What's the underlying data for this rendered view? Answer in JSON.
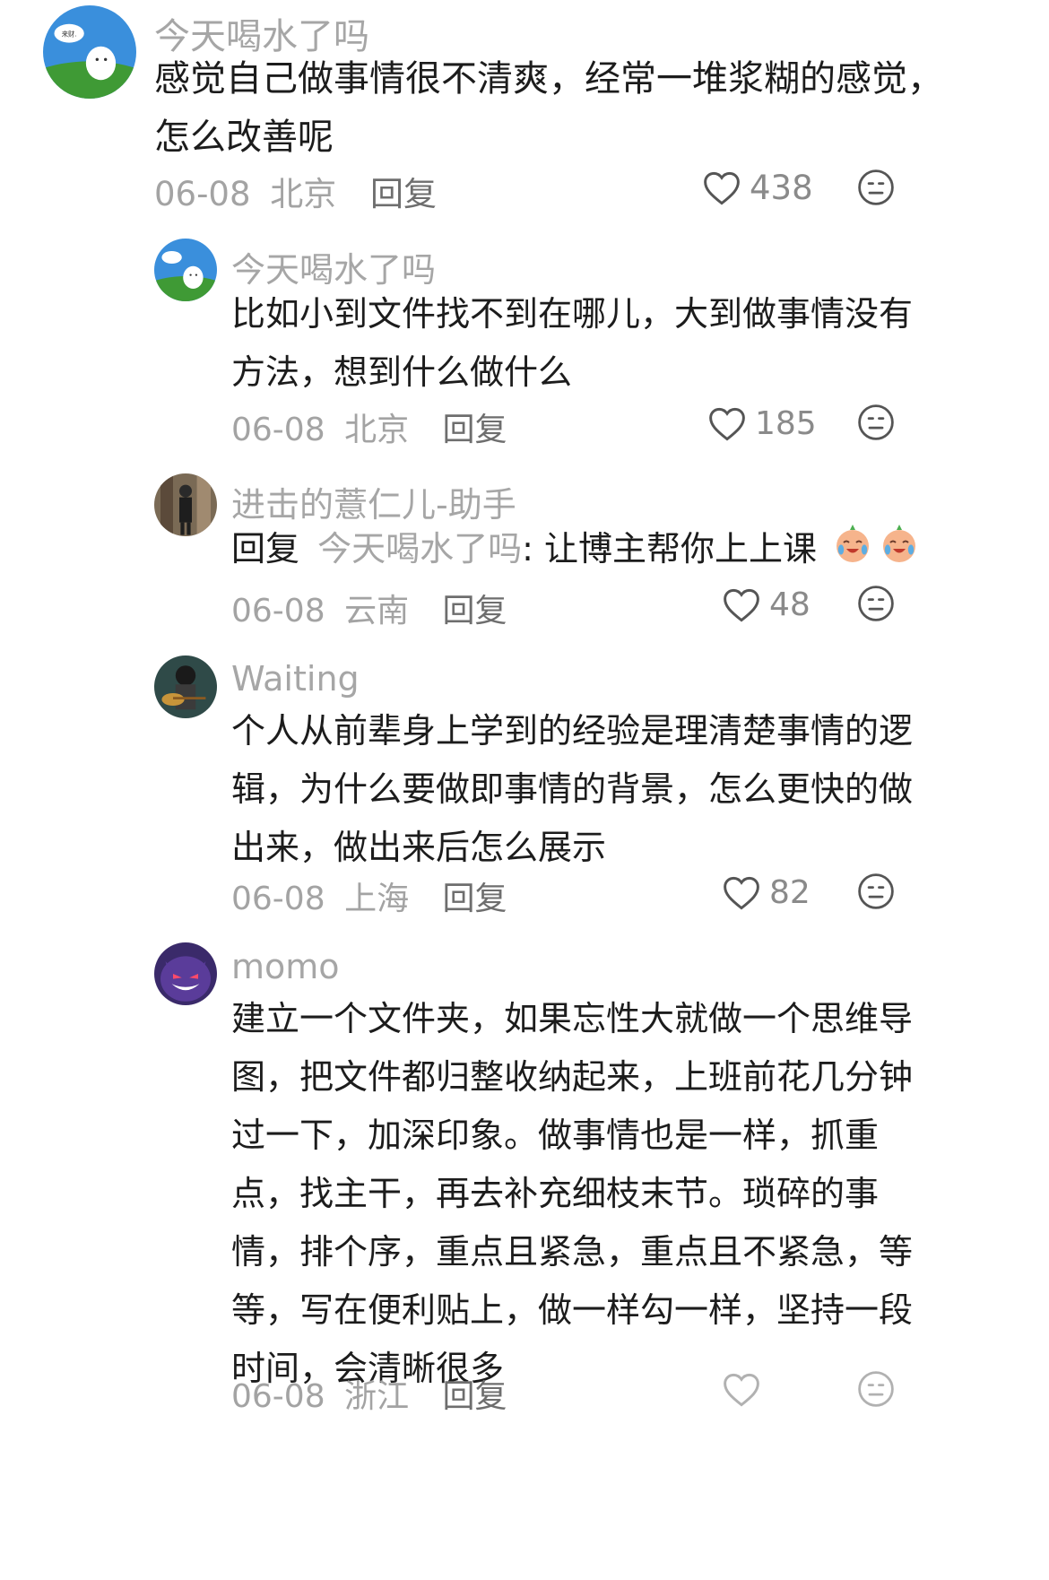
{
  "main_comment": {
    "username": "今天喝水了吗",
    "text_lines": [
      "感觉自己做事情很不清爽，经常一堆浆糊的感觉，",
      "怎么改善呢"
    ],
    "date": "06-08",
    "location": "北京",
    "reply_label": "回复",
    "likes": "438"
  },
  "replies": [
    {
      "username": "今天喝水了吗",
      "text_lines": [
        "比如小到文件找不到在哪儿，大到做事情没有",
        "方法，想到什么做什么"
      ],
      "date": "06-08",
      "location": "北京",
      "reply_label": "回复",
      "likes": "185"
    },
    {
      "username": "进击的薏仁儿-助手",
      "reply_prefix": "回复",
      "reply_target": "今天喝水了吗",
      "reply_text": ": 让博主帮你上上课",
      "date": "06-08",
      "location": "云南",
      "reply_label": "回复",
      "likes": "48"
    },
    {
      "username": "Waiting",
      "text_lines": [
        "个人从前辈身上学到的经验是理清楚事情的逻",
        "辑，为什么要做即事情的背景，怎么更快的做",
        "出来，做出来后怎么展示"
      ],
      "date": "06-08",
      "location": "上海",
      "reply_label": "回复",
      "likes": "82"
    },
    {
      "username": "momo",
      "text_lines": [
        "建立一个文件夹，如果忘性大就做一个思维导",
        "图，把文件都归整收纳起来，上班前花几分钟",
        "过一下，加深印象。做事情也是一样，抓重",
        "点，找主干，再去补充细枝末节。琐碎的事",
        "情，排个序，重点且紧急，重点且不紧急，等",
        "等，写在便利贴上，做一样勾一样，坚持一段",
        "时间，会清晰很多"
      ],
      "date": "06-08",
      "location": "浙江",
      "reply_label": "回复",
      "likes": ""
    }
  ],
  "icons": {
    "like": "heart-outline-icon",
    "dislike": "neutral-face-icon"
  },
  "colors": {
    "username": "#a6a6a6",
    "meta": "#a3a3a3",
    "text": "#1c1c1c"
  }
}
